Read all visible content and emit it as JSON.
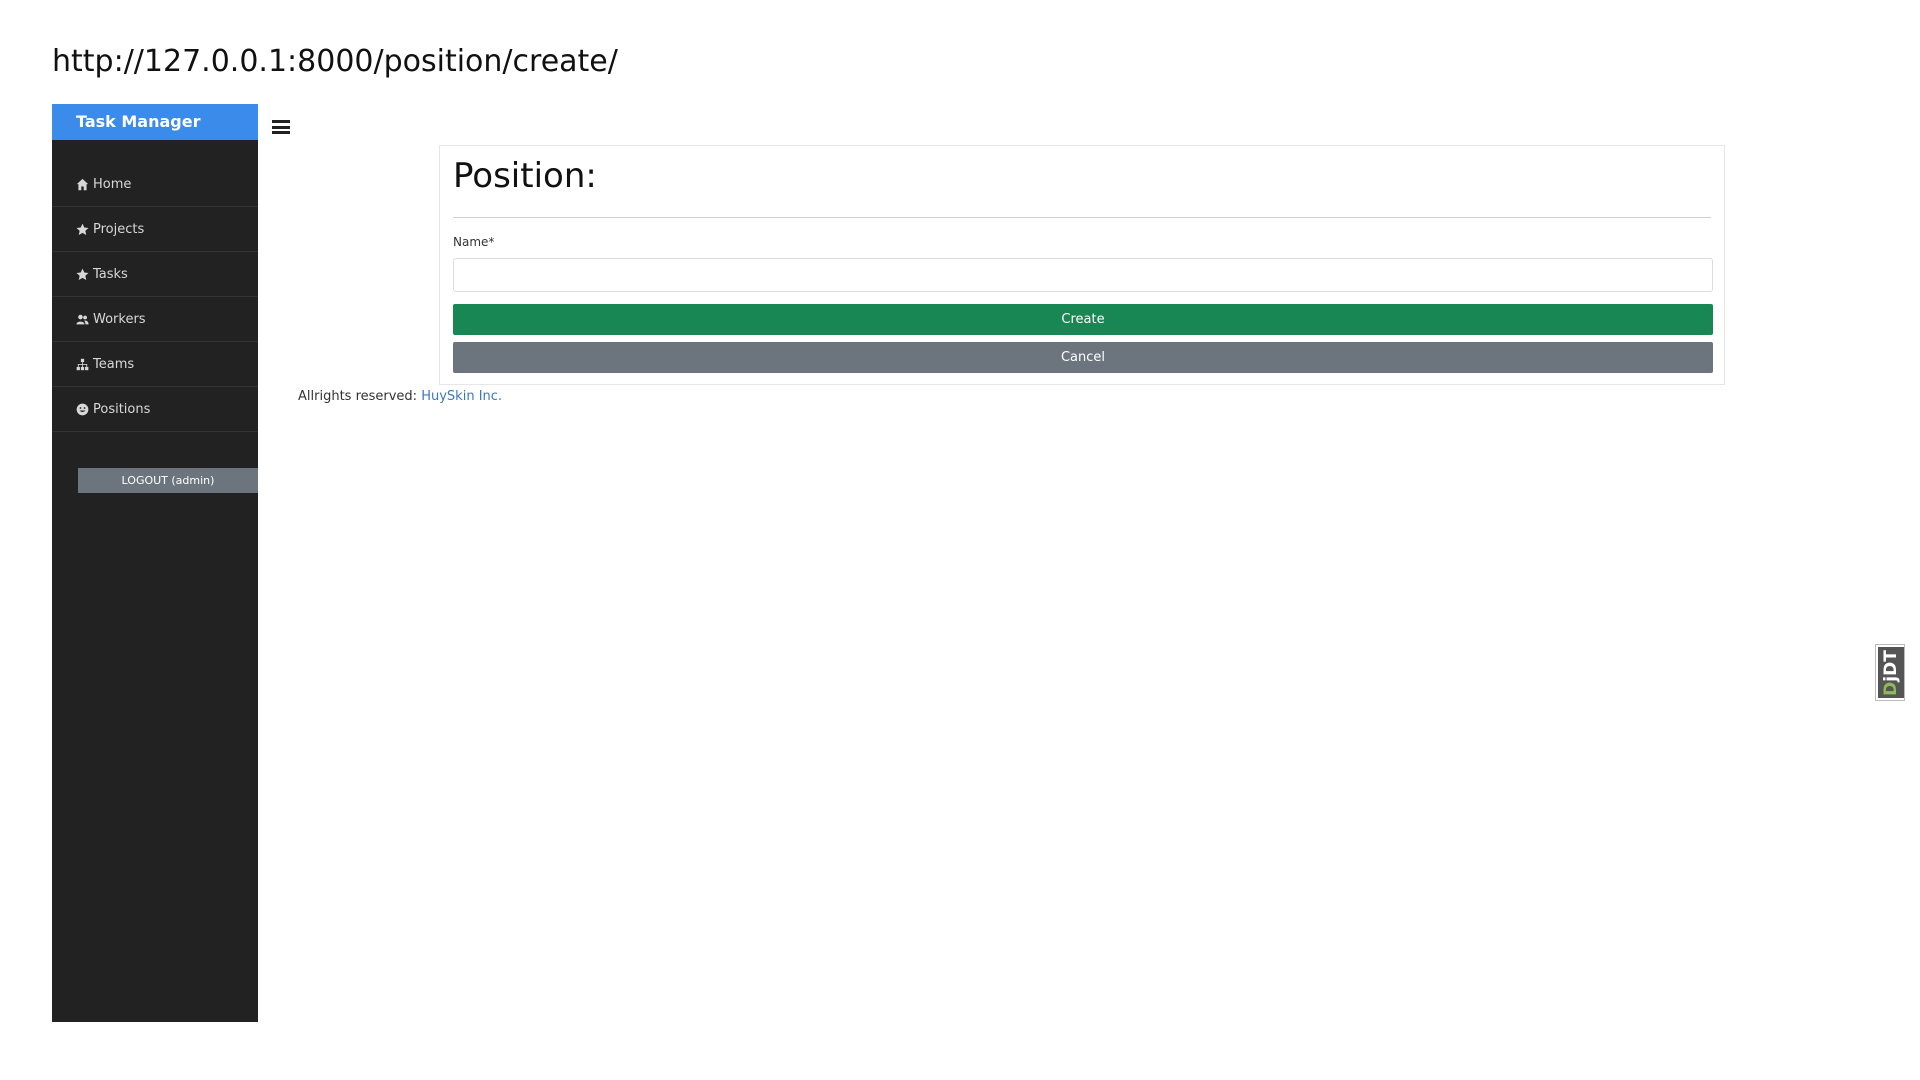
{
  "url_caption": "http://127.0.0.1:8000/position/create/",
  "sidebar": {
    "brand": "Task Manager",
    "items": [
      {
        "label": "Home",
        "icon": "home-icon"
      },
      {
        "label": "Projects",
        "icon": "star-icon"
      },
      {
        "label": "Tasks",
        "icon": "star-icon"
      },
      {
        "label": "Workers",
        "icon": "users-icon"
      },
      {
        "label": "Teams",
        "icon": "sitemap-icon"
      },
      {
        "label": "Positions",
        "icon": "smile-icon"
      }
    ],
    "logout_label": "LOGOUT (admin)"
  },
  "main": {
    "menu_icon": "hamburger-icon",
    "title": "Position:",
    "form": {
      "name_label": "Name*",
      "name_value": "",
      "create_label": "Create",
      "cancel_label": "Cancel"
    },
    "footer": {
      "text": "Allrights reserved:",
      "link_text": "HuySkin Inc."
    }
  },
  "debug_toolbar": {
    "prefix": "D",
    "rest": "jDT"
  },
  "colors": {
    "sidebar_bg": "#222222",
    "brand_bg": "#3b8beb",
    "create_button": "#198754",
    "cancel_button": "#6c757d",
    "link": "#3b78c4"
  }
}
